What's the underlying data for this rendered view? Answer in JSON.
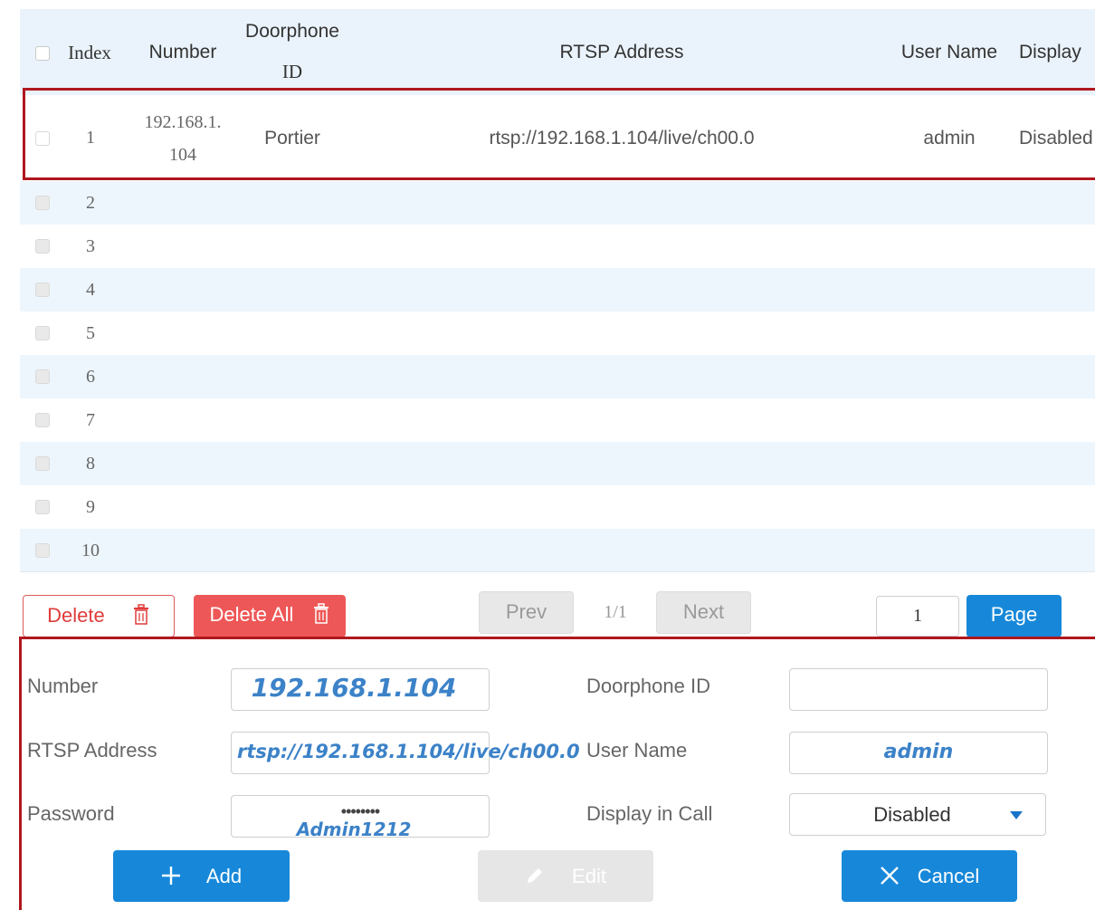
{
  "table": {
    "headers": {
      "index": "Index",
      "number": "Number",
      "doorphone_id_line1": "Doorphone",
      "doorphone_id_line2": "ID",
      "rtsp_address": "RTSP Address",
      "user_name": "User Name",
      "display": "Display"
    },
    "row1": {
      "index": "1",
      "number_line1": "192.168.1.",
      "number_line2": "104",
      "doorphone_id": "Portier",
      "rtsp_address": "rtsp://192.168.1.104/live/ch00.0",
      "user_name": "admin",
      "display": "Disabled"
    },
    "empty_rows": [
      "2",
      "3",
      "4",
      "5",
      "6",
      "7",
      "8",
      "9",
      "10"
    ]
  },
  "pagination": {
    "delete_label": "Delete",
    "delete_all_label": "Delete All",
    "prev_label": "Prev",
    "page_indicator": "1/1",
    "next_label": "Next",
    "page_input_value": "1",
    "page_label": "Page"
  },
  "form": {
    "number_label": "Number",
    "number_overlay": "192.168.1.104",
    "doorphone_id_label": "Doorphone ID",
    "rtsp_label": "RTSP Address",
    "rtsp_overlay": "rtsp://192.168.1.104/live/ch00.0",
    "user_name_label": "User Name",
    "user_name_overlay": "admin",
    "password_label": "Password",
    "password_masked": "••••••••",
    "password_overlay": "Admin1212",
    "display_in_call_label": "Display in Call",
    "display_in_call_value": "Disabled",
    "add_label": "Add",
    "edit_label": "Edit",
    "cancel_label": "Cancel"
  },
  "colors": {
    "primary_blue": "#1788d9",
    "danger_red": "#ee5757",
    "highlight_box": "#b0171f",
    "overlay_text": "#3c82c8"
  }
}
